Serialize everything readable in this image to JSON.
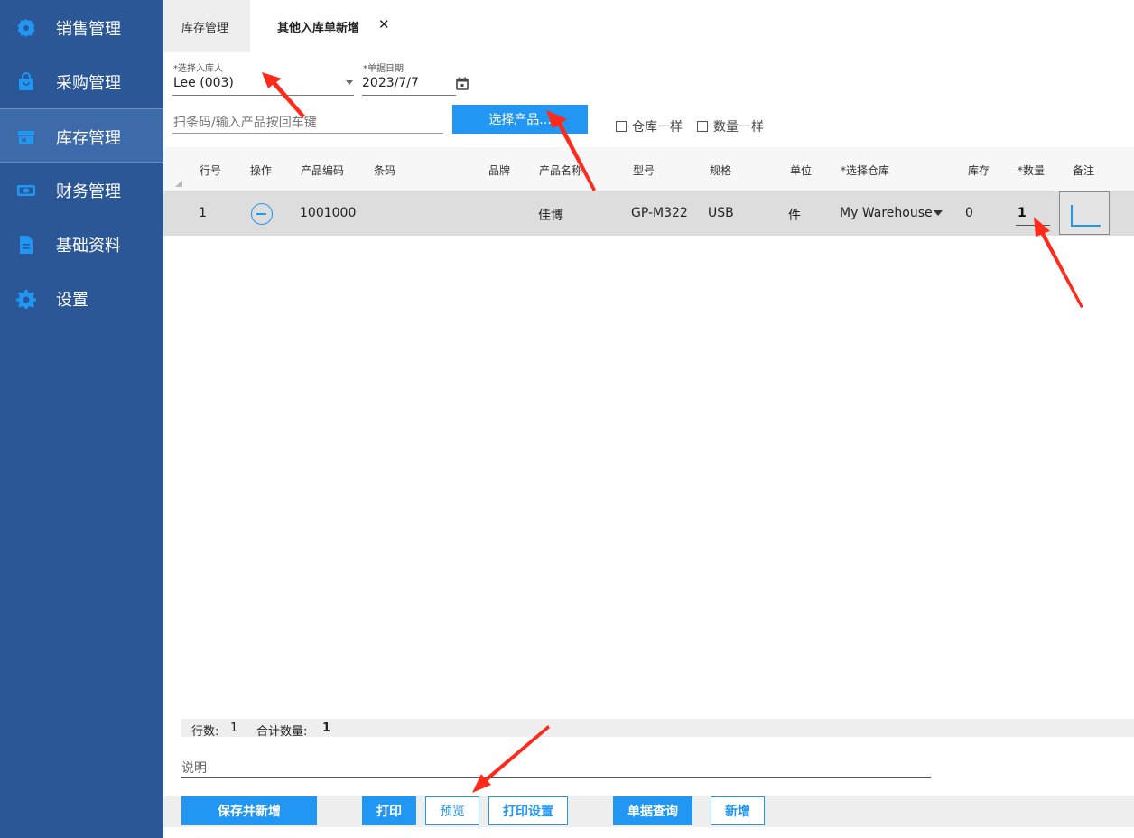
{
  "sidebar": {
    "items": [
      {
        "label": "销售管理",
        "icon": "gear-badge-icon"
      },
      {
        "label": "采购管理",
        "icon": "shopping-bag-icon"
      },
      {
        "label": "库存管理",
        "icon": "store-icon"
      },
      {
        "label": "财务管理",
        "icon": "money-icon"
      },
      {
        "label": "基础资料",
        "icon": "document-icon"
      },
      {
        "label": "设置",
        "icon": "gear-icon"
      }
    ],
    "active_index": 2
  },
  "tabs": [
    {
      "label": "库存管理"
    },
    {
      "label": "其他入库单新增",
      "close": "✕"
    }
  ],
  "form": {
    "receiver_label": "*选择入库人",
    "receiver_value": "Lee (003)",
    "date_label": "*单据日期",
    "date_value": "2023/7/7",
    "scan_placeholder": "扫条码/输入产品按回车键",
    "select_product_button": "选择产品...",
    "same_warehouse_label": "仓库一样",
    "same_quantity_label": "数量一样"
  },
  "table": {
    "headers": [
      "行号",
      "操作",
      "产品编码",
      "条码",
      "品牌",
      "产品名称",
      "型号",
      "规格",
      "单位",
      "*选择仓库",
      "库存",
      "*数量",
      "备注"
    ],
    "rows": [
      {
        "line_no": "1",
        "product_code": "1001000",
        "barcode": "",
        "brand": "",
        "product_name": "佳博",
        "model": "GP-M322",
        "spec": "USB",
        "unit": "件",
        "warehouse": "My Warehouse",
        "stock": "0",
        "quantity": "1",
        "note": ""
      }
    ]
  },
  "summary": {
    "rows_label": "行数:",
    "rows_value": "1",
    "total_label": "合计数量:",
    "total_value": "1"
  },
  "description_placeholder": "说明",
  "toolbar": {
    "save_new": "保存并新增",
    "print": "打印",
    "preview": "预览",
    "print_settings": "打印设置",
    "query": "单据查询",
    "new": "新增"
  },
  "colors": {
    "sidebar_bg": "#2b5797",
    "accent": "#2196f3",
    "annotation_arrow": "#ff2a1a"
  }
}
